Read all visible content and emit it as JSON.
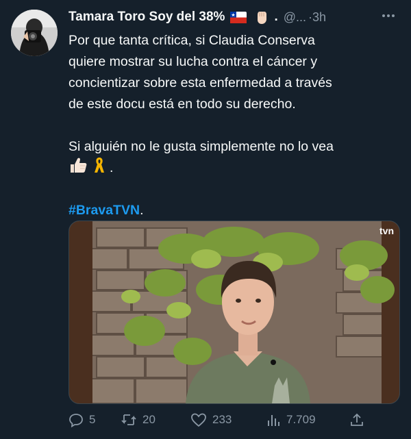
{
  "tweet": {
    "author_name": "Tamara Toro Soy del 38%",
    "handle": "@...",
    "time": "3h",
    "separator": ".",
    "text_lines": [
      "Por que tanta crítica, si Claudia Conserva",
      "quiere mostrar su lucha contra el cáncer y",
      "concientizar sobre esta enfermedad a través",
      "de este docu está en todo su derecho."
    ],
    "text_line2": "Si alguién no le gusta simplemente no lo vea",
    "emoji_trail": ".",
    "hashtag": "#BravaTVN",
    "hashtag_trail": ".",
    "media_logo": "tvn"
  },
  "actions": {
    "replies": "5",
    "retweets": "20",
    "likes": "233",
    "views": "7.709"
  },
  "icons": [
    "avatar",
    "chile-flag-icon",
    "raised-fist-icon",
    "more-icon",
    "thumbs-up-icon",
    "awareness-ribbon-icon",
    "reply-icon",
    "retweet-icon",
    "like-icon",
    "views-icon",
    "share-icon"
  ],
  "colors": {
    "background": "#15202b",
    "text": "#f7f9f9",
    "muted": "#8b98a5",
    "link": "#1d9bf0"
  }
}
